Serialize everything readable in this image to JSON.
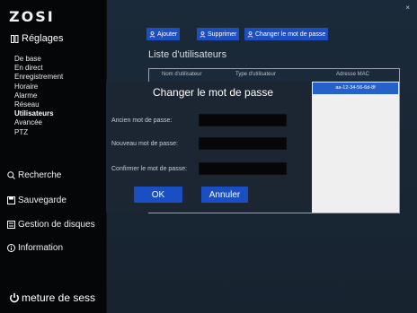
{
  "app": {
    "logo": "ZOSI"
  },
  "sidebar": {
    "section_title": "Réglages",
    "sub_items": [
      {
        "label": "De base",
        "active": false
      },
      {
        "label": "En direct",
        "active": false
      },
      {
        "label": "Enregistrement",
        "active": false
      },
      {
        "label": "Horaire",
        "active": false
      },
      {
        "label": "Alarme",
        "active": false
      },
      {
        "label": "Réseau",
        "active": false
      },
      {
        "label": "Utilisateurs",
        "active": true
      },
      {
        "label": "Avancée",
        "active": false
      },
      {
        "label": "PTZ",
        "active": false
      }
    ],
    "nav": {
      "search": "Recherche",
      "backup": "Sauvegarde",
      "disk": "Gestion de disques",
      "info": "Information"
    },
    "logout": "meture de sess"
  },
  "toolbar": {
    "add": "Ajouter",
    "delete": "Supprimer",
    "change_password": "Changer le mot de passe"
  },
  "panel": {
    "title": "Liste d'utilisateurs",
    "columns": [
      "Nom d'utilisateur",
      "Type d'utilisateur",
      "Adresse MAC"
    ],
    "selected_mac": "aa-12-34-56-6d-8f"
  },
  "dialog": {
    "title": "Changer le mot de passe",
    "fields": {
      "old": {
        "label": "Ancien mot de passe:",
        "value": ""
      },
      "new": {
        "label": "Nouveau mot de passe:",
        "value": ""
      },
      "confirm": {
        "label": "Confirmer le mot de passe:",
        "value": ""
      }
    },
    "ok": "OK",
    "cancel": "Annuler"
  },
  "window": {
    "close": "×"
  },
  "colors": {
    "accent": "#1d4fc0",
    "sidebar_bg": "#050608",
    "dialog_bg": "#1c2633"
  }
}
